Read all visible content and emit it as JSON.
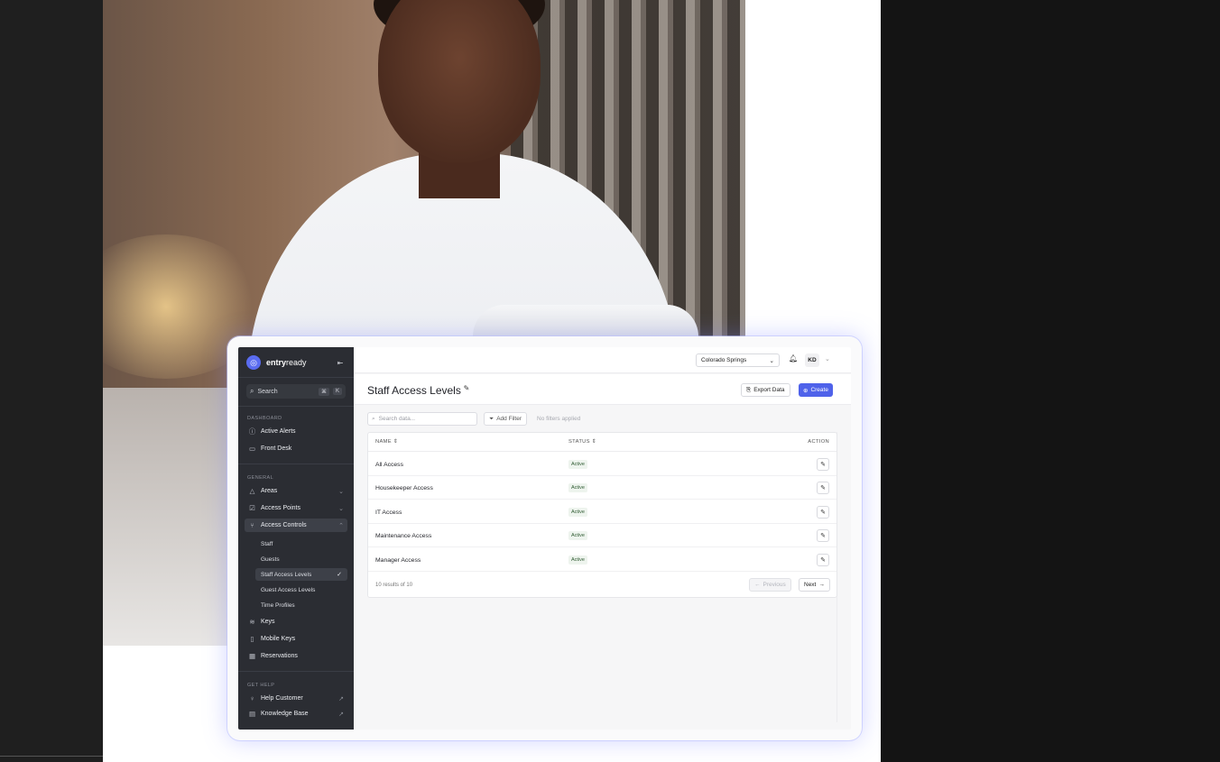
{
  "brand": {
    "name_bold": "entry",
    "name_rest": "ready"
  },
  "sidebar": {
    "search": {
      "label": "Search",
      "shortcut_mod": "⌘",
      "shortcut_key": "K"
    },
    "sections": {
      "dashboard": "DASHBOARD",
      "general": "GENERAL",
      "help": "GET HELP"
    },
    "dashboard_items": [
      {
        "label": "Active Alerts",
        "icon": "alert-circle-icon"
      },
      {
        "label": "Front Desk",
        "icon": "monitor-icon"
      }
    ],
    "general_items": [
      {
        "label": "Areas",
        "icon": "triangle-icon"
      },
      {
        "label": "Access Points",
        "icon": "checkbox-icon"
      },
      {
        "label": "Access Controls",
        "icon": "branch-icon"
      }
    ],
    "access_control_subitems": [
      {
        "label": "Staff"
      },
      {
        "label": "Guests"
      },
      {
        "label": "Staff Access Levels"
      },
      {
        "label": "Guest Access Levels"
      },
      {
        "label": "Time Profiles"
      }
    ],
    "more_items": [
      {
        "label": "Keys",
        "icon": "stack-icon"
      },
      {
        "label": "Mobile Keys",
        "icon": "phone-icon"
      },
      {
        "label": "Reservations",
        "icon": "grid-icon"
      }
    ],
    "help_items": [
      {
        "label": "Help Customer",
        "icon": "lightbulb-icon"
      },
      {
        "label": "Knowledge Base",
        "icon": "book-icon"
      }
    ]
  },
  "topbar": {
    "location": "Colorado Springs",
    "avatar": "KD"
  },
  "page": {
    "title": "Staff Access Levels",
    "export_label": "Export Data",
    "create_label": "Create"
  },
  "filters": {
    "search_placeholder": "Search data...",
    "add_filter_label": "Add Filter",
    "no_filters": "No filters applied"
  },
  "table": {
    "headers": {
      "name": "NAME",
      "status": "STATUS",
      "action": "ACTION"
    },
    "rows": [
      {
        "name": "All Access",
        "status": "Active"
      },
      {
        "name": "Housekeeper Access",
        "status": "Active"
      },
      {
        "name": "IT Access",
        "status": "Active"
      },
      {
        "name": "Maintenance Access",
        "status": "Active"
      },
      {
        "name": "Manager Access",
        "status": "Active"
      }
    ],
    "results": "10 results of 10",
    "prev_label": "Previous",
    "next_label": "Next"
  },
  "colors": {
    "accent": "#4f62ea",
    "sidebar_bg": "#2b2d33",
    "status_text": "#2f5b32"
  }
}
